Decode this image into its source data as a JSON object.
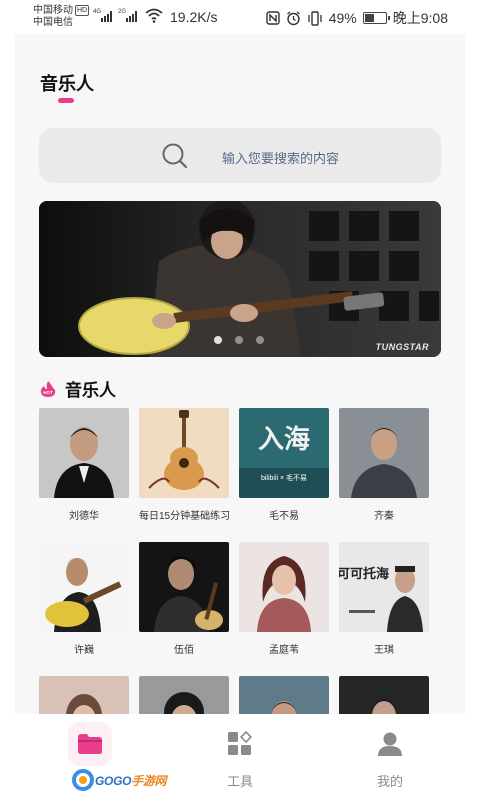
{
  "status_bar": {
    "carrier_1": "中国移动",
    "hd_badge": "HD",
    "carrier_2": "中国电信",
    "network_1": "4G",
    "network_2": "2G",
    "net_speed": "19.2K/s",
    "battery_percent": "49%",
    "battery_level": 0.49,
    "time": "晚上9:08"
  },
  "header": {
    "title": "音乐人"
  },
  "search": {
    "placeholder": "输入您要搜索的内容"
  },
  "banner": {
    "watermark": "TUNGSTAR",
    "slide_count": 3,
    "active_slide": 0
  },
  "section": {
    "title": "音乐人",
    "hot_badge": "HOT"
  },
  "artists": [
    {
      "name": "刘德华"
    },
    {
      "name": "每日15分钟基础练习"
    },
    {
      "name": "毛不易",
      "overlay_title": "入海",
      "overlay_sub": "bilibili × 毛不易"
    },
    {
      "name": "齐秦"
    },
    {
      "name": "许巍"
    },
    {
      "name": "伍佰"
    },
    {
      "name": "孟庭苇"
    },
    {
      "name": "王琪",
      "overlay_title": "可可托海"
    },
    {
      "name": ""
    },
    {
      "name": ""
    },
    {
      "name": ""
    },
    {
      "name": ""
    }
  ],
  "tabbar": {
    "tabs": [
      {
        "label": "",
        "icon": "folder-icon",
        "active": true
      },
      {
        "label": "工具",
        "icon": "grid-icon"
      },
      {
        "label": "我的",
        "icon": "person-icon"
      }
    ],
    "logo_text_1": "GOGO",
    "logo_text_2": "手游网"
  },
  "colors": {
    "accent": "#e83e8c",
    "page_bg": "#f7f7f7",
    "search_bg": "#eaeaea"
  }
}
